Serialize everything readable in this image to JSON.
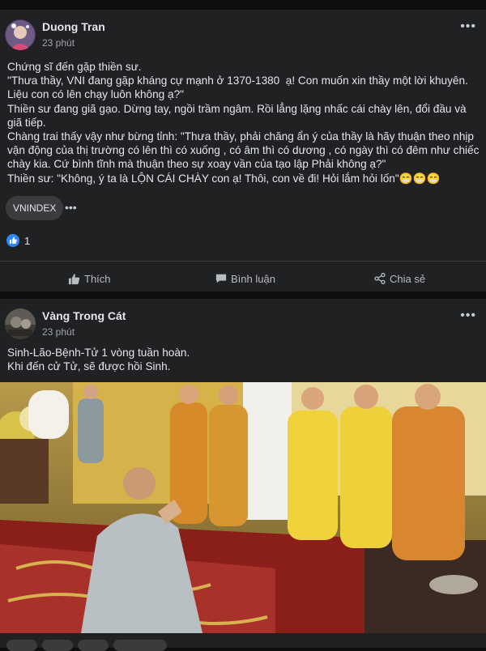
{
  "colors": {
    "background": "#0d0e10",
    "card": "#202123",
    "text": "#e4e6eb",
    "muted": "#a0a3a8",
    "like_blue": "#2d88ff"
  },
  "post1": {
    "author": "Duong Tran",
    "time": "23 phút",
    "more_icon": "more-horizontal-icon",
    "body": "Chứng sĩ đến gặp thiền sư.\n\"Thưa thầy, VNI đang gặp kháng cự mạnh ở 1370-1380  ạ! Con muốn xin thầy một lời khuyên. Liệu con có lên chạy luôn không ạ?\"\nThiền sư đang giã gạo. Dừng tay, ngồi trầm ngâm. Rồi lẳng lặng nhấc cái chày lên, đổi đầu và giã tiếp.\nChàng trai thấy vậy như bừng tỉnh: \"Thưa thầy, phải chăng ẩn ý của thầy là hãy thuận theo nhịp vận động của thị trường có lên thì có xuống , có âm thì có dương , có ngày thì có đêm như chiếc chày kia. Cứ bình tĩnh mà thuận theo sự xoay vần của tạo lập Phải không ạ?\"\nThiền sư: \"Không, ý ta là LỘN CÁI CHÀY con ạ! Thôi, con về đi! Hỏi lắm hỏi lốn\"😁😁😁",
    "tag": "VNINDEX",
    "like_count": "1",
    "actions": {
      "like": "Thích",
      "comment": "Bình luận",
      "share": "Chia sẻ"
    }
  },
  "post2": {
    "author": "Vàng Trong Cát",
    "time": "23 phút",
    "more_icon": "more-horizontal-icon",
    "body": "Sinh-Lão-Bệnh-Tử 1 vòng tuần hoàn.\nKhi đến cử Tử, sẽ được hồi Sinh."
  }
}
